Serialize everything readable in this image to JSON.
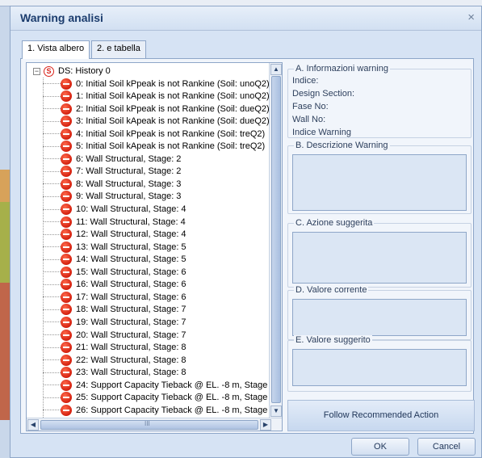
{
  "dialog": {
    "title": "Warning analisi",
    "close_glyph": "×"
  },
  "tabs": [
    {
      "label": "1. Vista albero",
      "active": true
    },
    {
      "label": "2. e tabella",
      "active": false
    }
  ],
  "tree": {
    "root_label": "DS: History 0",
    "root_icon": "S",
    "expander": "−",
    "items": [
      "0: Initial Soil kPpeak is not Rankine (Soil: unoQ2)",
      "1: Initial Soil kApeak is not Rankine (Soil: unoQ2)",
      "2: Initial Soil kPpeak is not Rankine (Soil: dueQ2)",
      "3: Initial Soil kApeak is not Rankine (Soil: dueQ2)",
      "4: Initial Soil kPpeak is not Rankine (Soil: treQ2)",
      "5: Initial Soil kApeak is not Rankine (Soil: treQ2)",
      "6: Wall Structural, Stage: 2",
      "7: Wall Structural, Stage: 2",
      "8: Wall Structural, Stage: 3",
      "9: Wall Structural, Stage: 3",
      "10: Wall Structural, Stage: 4",
      "11: Wall Structural, Stage: 4",
      "12: Wall Structural, Stage: 4",
      "13: Wall Structural, Stage: 5",
      "14: Wall Structural, Stage: 5",
      "15: Wall Structural, Stage: 6",
      "16: Wall Structural, Stage: 6",
      "17: Wall Structural, Stage: 6",
      "18: Wall Structural, Stage: 7",
      "19: Wall Structural, Stage: 7",
      "20: Wall Structural, Stage: 7",
      "21: Wall Structural, Stage: 8",
      "22: Wall Structural, Stage: 8",
      "23: Wall Structural, Stage: 8",
      "24: Support Capacity Tieback @ EL. -8 m, Stage",
      "25: Support Capacity Tieback @ EL. -8 m, Stage",
      "26: Support Capacity Tieback @ EL. -8 m, Stage"
    ],
    "scroll_up": "▲",
    "scroll_down": "▼",
    "scroll_left": "◀",
    "scroll_right": "▶",
    "thumb_grip": "III"
  },
  "info": {
    "group_a": "A. Informazioni warning",
    "indice": "Indice:",
    "design_section": "Design Section:",
    "fase_no": "Fase No:",
    "wall_no": "Wall No:",
    "indice_warning": "Indice Warning",
    "group_b": "B. Descrizione Warning",
    "group_c": "C. Azione suggerita",
    "group_d": "D. Valore corrente",
    "group_e": "E. Valore suggerito",
    "follow_button": "Follow Recommended Action"
  },
  "footer": {
    "ok": "OK",
    "cancel": "Cancel"
  }
}
